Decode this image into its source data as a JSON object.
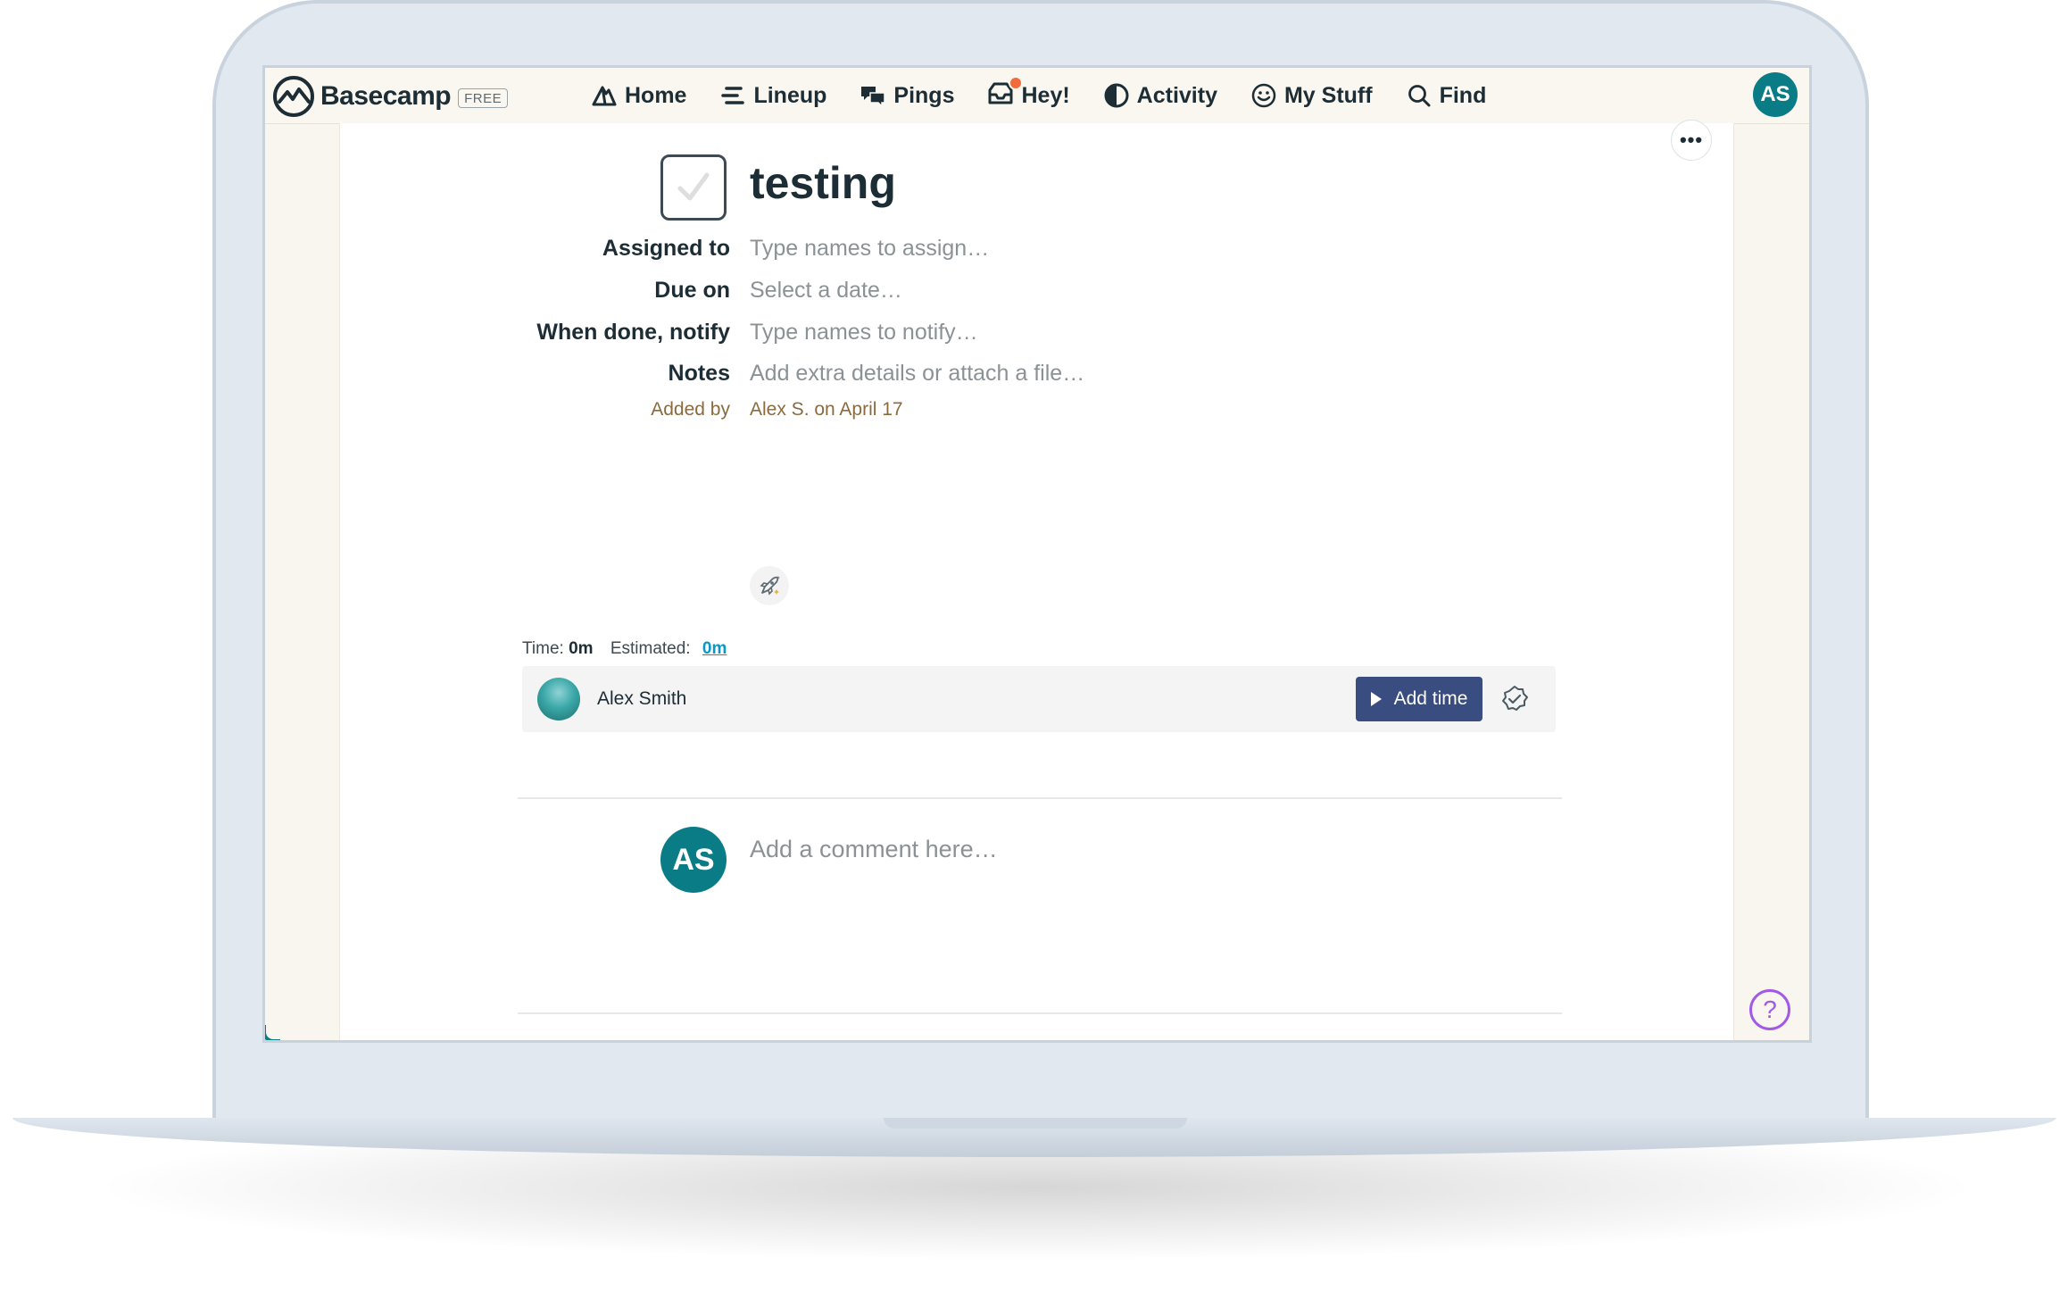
{
  "app": {
    "brand": "Basecamp",
    "plan_badge": "FREE",
    "colors": {
      "accent": "#0a7c86",
      "button": "#3a4d80",
      "link": "#0a96c6",
      "notification": "#f26b3a",
      "help": "#a25ae6"
    }
  },
  "nav": {
    "items": [
      {
        "label": "Home",
        "icon": "mountain-icon"
      },
      {
        "label": "Lineup",
        "icon": "lineup-icon"
      },
      {
        "label": "Pings",
        "icon": "chat-bubbles-icon"
      },
      {
        "label": "Hey!",
        "icon": "inbox-icon"
      },
      {
        "label": "Activity",
        "icon": "activity-icon"
      },
      {
        "label": "My Stuff",
        "icon": "smiley-icon"
      },
      {
        "label": "Find",
        "icon": "search-icon"
      }
    ],
    "user_initials": "AS"
  },
  "todo": {
    "title": "testing",
    "fields": {
      "assigned_label": "Assigned to",
      "assigned_placeholder": "Type names to assign…",
      "due_label": "Due on",
      "due_placeholder": "Select a date…",
      "notify_label": "When done, notify",
      "notify_placeholder": "Type names to notify…",
      "notes_label": "Notes",
      "notes_placeholder": "Add extra details or attach a file…"
    },
    "added_by_label": "Added by",
    "added_by_value": "Alex S. on April 17"
  },
  "time_tracking": {
    "time_label": "Time:",
    "time_value": "0m",
    "estimated_label": "Estimated:",
    "estimated_value": "0m",
    "user_name": "Alex Smith",
    "add_time_label": "Add time"
  },
  "comment": {
    "avatar_initials": "AS",
    "placeholder": "Add a comment here…"
  },
  "help_label": "?",
  "more_label": "•••"
}
